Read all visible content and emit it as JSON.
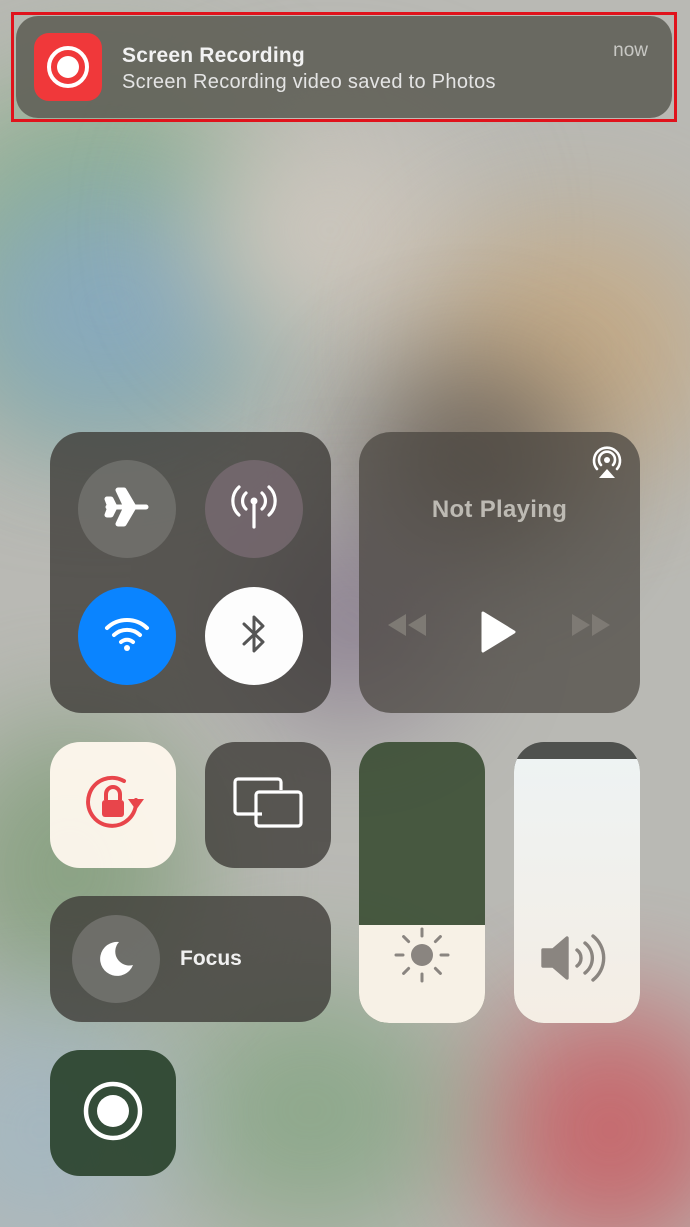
{
  "notification": {
    "app_icon": "screen-recording-icon",
    "title": "Screen Recording",
    "body": "Screen Recording video saved to Photos",
    "time": "now",
    "highlight_color": "#e0131c"
  },
  "connectivity": {
    "airplane_mode": {
      "icon": "airplane-icon",
      "on": false
    },
    "cellular_data": {
      "icon": "antenna-icon",
      "on": false
    },
    "wifi": {
      "icon": "wifi-icon",
      "on": true,
      "color": "#0a84ff"
    },
    "bluetooth": {
      "icon": "bluetooth-icon",
      "on": true
    }
  },
  "media": {
    "status": "Not Playing",
    "controls": [
      "rewind-icon",
      "play-icon",
      "fast-forward-icon"
    ],
    "airplay_icon": "airplay-audio-icon"
  },
  "toggles": {
    "orientation_lock": {
      "icon": "orientation-lock-icon",
      "on": true,
      "color": "#e8454b"
    },
    "screen_mirroring": {
      "icon": "screen-mirroring-icon"
    },
    "focus": {
      "icon": "moon-icon",
      "label": "Focus"
    },
    "screen_recording": {
      "icon": "record-icon"
    }
  },
  "sliders": {
    "brightness": {
      "icon": "sun-icon",
      "level_fraction": 0.35
    },
    "volume": {
      "icon": "speaker-icon",
      "level_fraction": 0.94
    }
  }
}
